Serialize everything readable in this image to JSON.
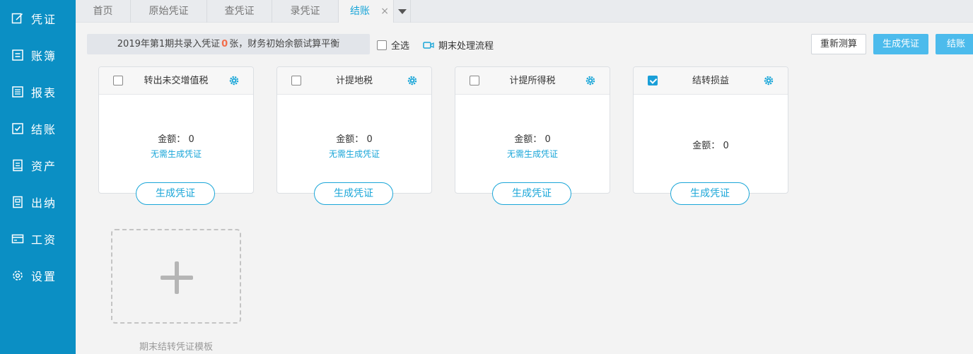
{
  "sidebar": {
    "items": [
      {
        "label": "凭证",
        "icon": "voucher-edit-icon"
      },
      {
        "label": "账簿",
        "icon": "ledger-book-icon"
      },
      {
        "label": "报表",
        "icon": "report-list-icon"
      },
      {
        "label": "结账",
        "icon": "checkout-check-icon"
      },
      {
        "label": "资产",
        "icon": "asset-doc-icon"
      },
      {
        "label": "出纳",
        "icon": "cashier-doc-icon"
      },
      {
        "label": "工资",
        "icon": "salary-card-icon"
      },
      {
        "label": "设置",
        "icon": "gear-icon"
      }
    ],
    "bg_color": "#0b8fc4"
  },
  "tabs": [
    {
      "label": "首页"
    },
    {
      "label": "原始凭证"
    },
    {
      "label": "查凭证"
    },
    {
      "label": "录凭证"
    },
    {
      "label": "结账",
      "active": true,
      "close": "×"
    }
  ],
  "toolbar": {
    "info_prefix": "2019年第1期共录入凭证",
    "info_count": "0",
    "info_suffix": "张，财务初始余额试算平衡",
    "select_all_label": "全选",
    "flow_label": "期末处理流程",
    "recalc_label": "重新测算",
    "generate_label": "生成凭证",
    "close_label": "结账"
  },
  "cards": [
    {
      "title": "转出未交增值税",
      "checked": false,
      "amount_label": "金额：",
      "amount": "0",
      "note": "无需生成凭证",
      "button": "生成凭证"
    },
    {
      "title": "计提地税",
      "checked": false,
      "amount_label": "金额：",
      "amount": "0",
      "note": "无需生成凭证",
      "button": "生成凭证"
    },
    {
      "title": "计提所得税",
      "checked": false,
      "amount_label": "金额：",
      "amount": "0",
      "note": "无需生成凭证",
      "button": "生成凭证"
    },
    {
      "title": "结转损益",
      "checked": true,
      "amount_label": "金额：",
      "amount": "0",
      "note": "",
      "button": "生成凭证"
    }
  ],
  "template": {
    "label": "期末结转凭证模板"
  },
  "colors": {
    "accent": "#1aa6d8",
    "primary_button": "#4cbbec",
    "count_highlight": "#f26d4b"
  }
}
